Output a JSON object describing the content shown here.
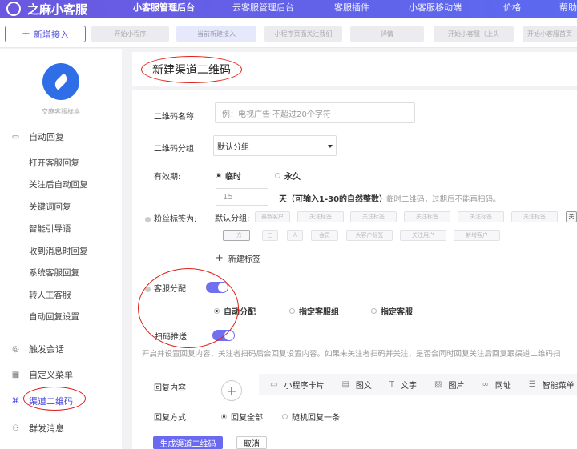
{
  "nav": {
    "brand": "之麻小客服",
    "items": [
      "小客服管理后台",
      "云客服管理后台",
      "客服插件",
      "小客服移动端",
      "价格",
      "帮助"
    ]
  },
  "tabs": {
    "new_tab": "新增接入",
    "chips": [
      "开始小程序",
      "当前新建接入",
      "小程序页面关注我们",
      "详情",
      "开始小客服（上头",
      "开始小客服首页"
    ]
  },
  "sidebar": {
    "account": "交麻客服标本",
    "groups": [
      {
        "label": "自动回复",
        "icon": "message-icon"
      },
      {
        "label": "触发会话",
        "icon": "signal-icon"
      },
      {
        "label": "自定义菜单",
        "icon": "grid-icon"
      },
      {
        "label": "渠道二维码",
        "icon": "qrcode-icon"
      },
      {
        "label": "群发消息",
        "icon": "users-icon"
      }
    ],
    "subitems": [
      "打开客服回复",
      "关注后自动回复",
      "关键词回复",
      "智能引导语",
      "收到消息时回复",
      "系统客服回复",
      "转人工客服",
      "自动回复设置"
    ]
  },
  "page": {
    "title": "新建渠道二维码"
  },
  "form": {
    "name_label": "二维码名称",
    "name_placeholder": "例：电视广告 不超过20个字符",
    "group_label": "二维码分组",
    "group_value": "默认分组",
    "validity_label": "有效期:",
    "validity_options": [
      "临时",
      "永久"
    ],
    "days_value": "15",
    "days_text_prefix": "天（可输入1-30的自然整数）",
    "days_hint": "临时二维码，过期后不能再扫码。",
    "tags_label": "粉丝标签为:",
    "tags_group": "默认分组:",
    "tag_chips_row1": [
      "最新客户",
      "关注标签",
      "关注标签",
      "关注标签",
      "关注标签",
      "关注标签",
      "关"
    ],
    "tag_chips_row2": [
      "一方",
      "三",
      "人",
      "会员",
      "大客户标签",
      "关注用户",
      "新增客户"
    ],
    "add_tag": "新建标签",
    "service_label": "客服分配",
    "service_options": [
      "自动分配",
      "指定客服组",
      "指定客服"
    ],
    "push_label": "扫码推送",
    "push_hint": "开启并设置回复内容，关注者扫码后会回复设置内容。如果未关注者扫码并关注，是否会同时回复关注后回复跟渠道二维码扫",
    "reply_label": "回复内容",
    "reply_options": [
      {
        "icon": "miniapp-icon",
        "label": "小程序卡片"
      },
      {
        "icon": "image-text-icon",
        "label": "图文"
      },
      {
        "icon": "text-icon",
        "label": "文字"
      },
      {
        "icon": "picture-icon",
        "label": "图片"
      },
      {
        "icon": "link-icon",
        "label": "网址"
      },
      {
        "icon": "menu-icon",
        "label": "智能菜单"
      }
    ],
    "method_label": "回复方式",
    "method_options": [
      "回复全部",
      "随机回复一条"
    ],
    "submit": "生成渠道二维码",
    "cancel": "取消"
  },
  "colors": {
    "accent": "#6a6af0",
    "annotation": "#e0201a"
  }
}
